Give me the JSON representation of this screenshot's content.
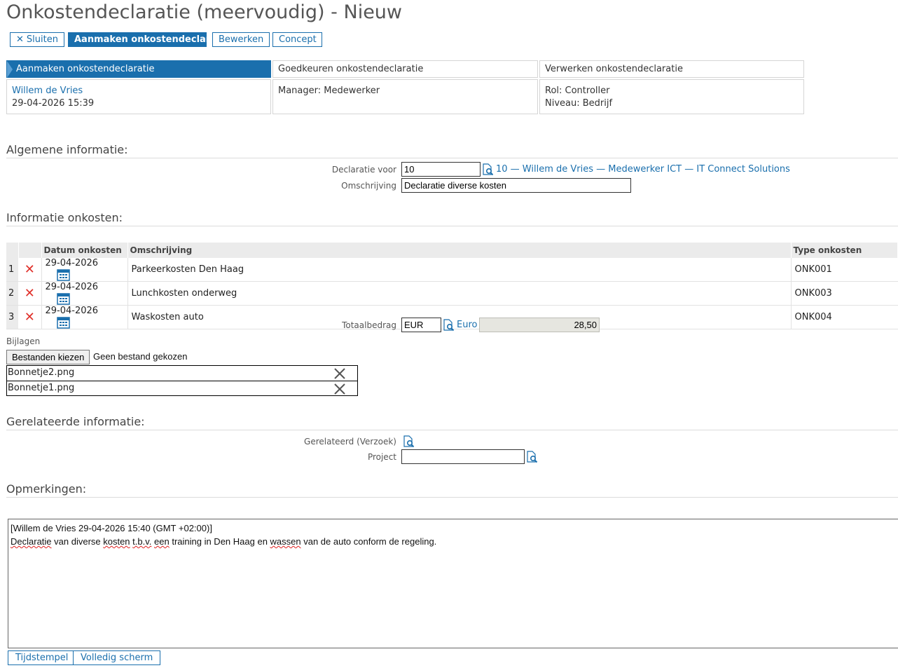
{
  "page": {
    "title": "Onkostendeclaratie (meervoudig) - Nieuw"
  },
  "toolbar": {
    "close_label": "Sluiten",
    "create_label": "Aanmaken onkostendeclaratie",
    "edit_label": "Bewerken",
    "concept_label": "Concept"
  },
  "workflow": {
    "steps": [
      {
        "title": "Aanmaken onkostendeclaratie",
        "line1": "Willem de Vries",
        "line2": "29-04-2026 15:39"
      },
      {
        "title": "Goedkeuren onkostendeclaratie",
        "line1": "Manager: Medewerker",
        "line2": ""
      },
      {
        "title": "Verwerken onkostendeclaratie",
        "line1": "Rol: Controller",
        "line2": "Niveau: Bedrijf"
      }
    ]
  },
  "general": {
    "heading": "Algemene informatie:",
    "declaration_for_label": "Declaratie voor",
    "declaration_for_value": "10",
    "declaration_for_link": "10 — Willem de Vries — Medewerker ICT — IT Connect Solutions",
    "description_label": "Omschrijving",
    "description_value": "Declaratie diverse kosten"
  },
  "expenses": {
    "heading": "Informatie onkosten:",
    "columns": {
      "date": "Datum onkosten",
      "description": "Omschrijving",
      "type": "Type onkosten"
    },
    "rows": [
      {
        "num": "1",
        "date": "29-04-2026",
        "description": "Parkeerkosten Den Haag",
        "type": "ONK001"
      },
      {
        "num": "2",
        "date": "29-04-2026",
        "description": "Lunchkosten onderweg",
        "type": "ONK003"
      },
      {
        "num": "3",
        "date": "29-04-2026",
        "description": "Waskosten auto",
        "type": "ONK004"
      }
    ],
    "total_label": "Totaalbedrag",
    "currency_code": "EUR",
    "currency_name": "Euro",
    "total_amount": "28,50"
  },
  "attachments": {
    "label": "Bijlagen",
    "choose_label": "Bestanden kiezen",
    "none_chosen": "Geen bestand gekozen",
    "files": [
      "Bonnetje2.png",
      "Bonnetje1.png"
    ]
  },
  "related": {
    "heading": "Gerelateerde informatie:",
    "request_label": "Gerelateerd (Verzoek)",
    "project_label": "Project",
    "project_value": ""
  },
  "remarks": {
    "heading": "Opmerkingen:",
    "line1": "[Willem de Vries 29-04-2026 15:40 (GMT +02:00)]",
    "w1": "Declaratie",
    "t1": " van diverse ",
    "w2": "kosten",
    "t2": " ",
    "w3": "t.b.v.",
    "t3": " ",
    "w4": "een",
    "t4": " training in Den Haag en ",
    "w5": "wassen",
    "t5": " van de auto conform de regeling.",
    "timestamp_label": "Tijdstempel",
    "fullscreen_label": "Volledig scherm"
  },
  "colors": {
    "accent": "#1a6fad",
    "delete": "#e0302a"
  }
}
